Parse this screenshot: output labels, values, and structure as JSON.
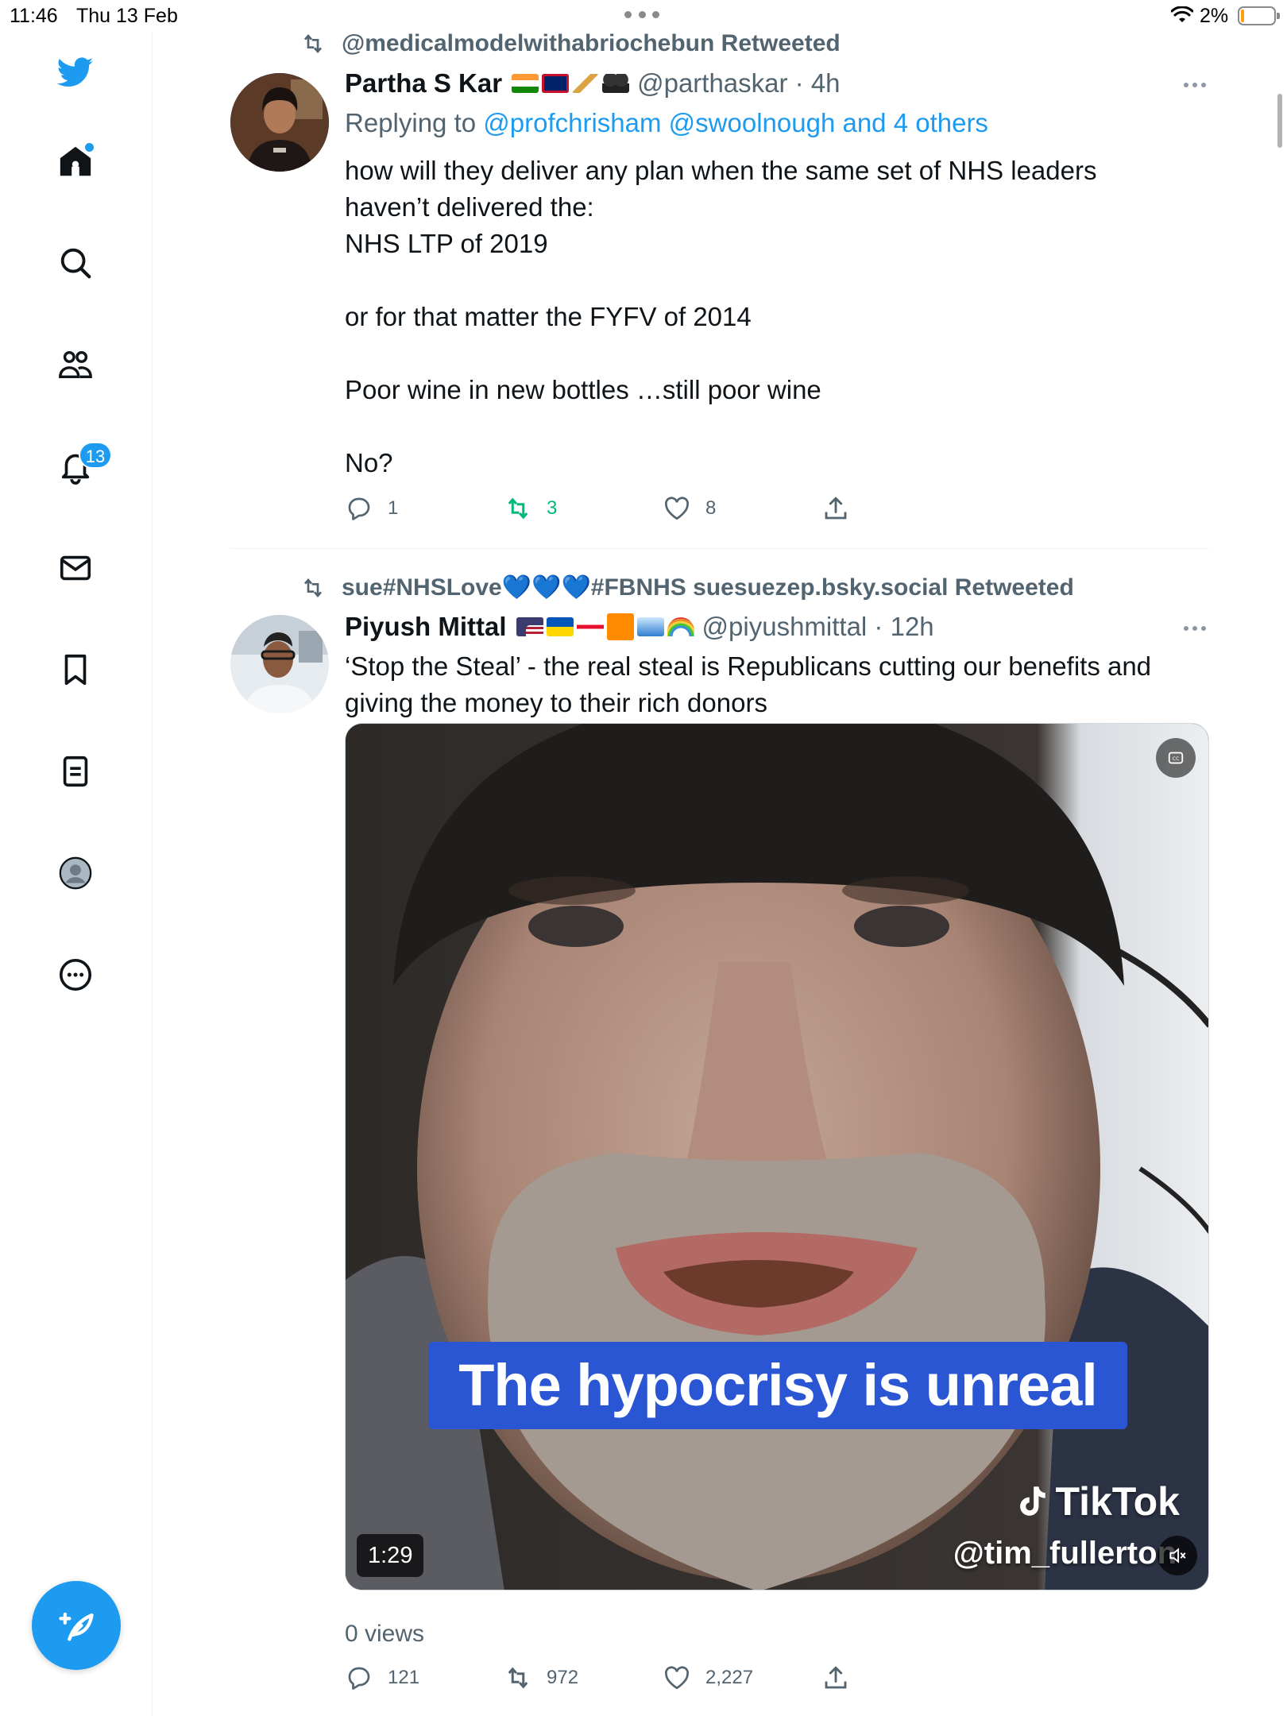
{
  "status_bar": {
    "time": "11:46",
    "date": "Thu 13 Feb",
    "battery": "2%"
  },
  "sidebar": {
    "items": [
      {
        "name": "logo",
        "icon": "twitter-bird-icon"
      },
      {
        "name": "home",
        "icon": "home-icon"
      },
      {
        "name": "explore",
        "icon": "search-icon"
      },
      {
        "name": "communities",
        "icon": "people-icon"
      },
      {
        "name": "notifications",
        "icon": "bell-icon",
        "badge": "13"
      },
      {
        "name": "messages",
        "icon": "mail-icon"
      },
      {
        "name": "bookmarks",
        "icon": "bookmark-icon"
      },
      {
        "name": "lists",
        "icon": "list-icon"
      },
      {
        "name": "profile",
        "icon": "profile-icon"
      },
      {
        "name": "more",
        "icon": "more-circle-icon"
      }
    ],
    "notifications_badge": "13"
  },
  "tweets": [
    {
      "retweeted_by": "@medicalmodelwithabriochebun Retweeted",
      "name": "Partha S Kar",
      "handle_time": "@parthaskar · 4h",
      "replying_prefix": "Replying to ",
      "replying_mentions": "@profchrisham @swoolnough and 4 others",
      "body": "how will they deliver any plan when the same set of NHS leaders\nhaven’t delivered the:\nNHS LTP of 2019\n\nor for that matter the FYFV of 2014\n\nPoor wine in new bottles …still poor wine\n\nNo?",
      "replies": "1",
      "retweets": "3",
      "likes": "8"
    },
    {
      "retweeted_by": "sue#NHSLove💙💙💙#FBNHS suesuezep.bsky.social Retweeted",
      "name": "Piyush Mittal",
      "handle_time": "@piyushmittal · 12h",
      "body": "‘Stop the Steal’ - the real steal is Republicans cutting our benefits and\ngiving the money to their rich donors",
      "video": {
        "caption": "The hypocrisy is unreal",
        "watermark": "TikTok",
        "watermark_user": "@tim_fullerton",
        "duration": "1:29"
      },
      "views": "0 views",
      "replies": "121",
      "retweets": "972",
      "likes": "2,227"
    }
  ],
  "colors": {
    "brand": "#1d9bf0",
    "retweet_active": "#00ba7c",
    "secondary_text": "#536471"
  }
}
